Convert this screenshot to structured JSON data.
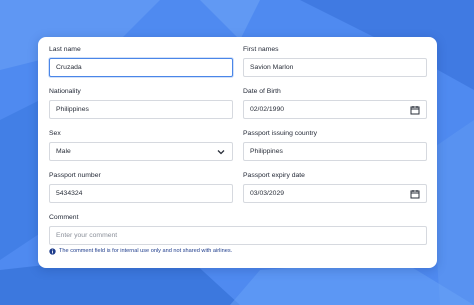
{
  "form": {
    "last_name": {
      "label": "Last name",
      "value": "Cruzada"
    },
    "first_names": {
      "label": "First names",
      "value": "Savion Marlon"
    },
    "nationality": {
      "label": "Nationality",
      "value": "Philippines"
    },
    "date_of_birth": {
      "label": "Date of Birth",
      "value": "02/02/1990"
    },
    "sex": {
      "label": "Sex",
      "value": "Male"
    },
    "passport_issuing_country": {
      "label": "Passport issuing country",
      "value": "Philippines"
    },
    "passport_number": {
      "label": "Passport number",
      "value": "5434324"
    },
    "passport_expiry_date": {
      "label": "Passport expiry date",
      "value": "03/03/2029"
    },
    "comment": {
      "label": "Comment",
      "placeholder": "Enter your comment"
    },
    "note": "The comment field is for internal use only and not shared with airlines."
  },
  "colors": {
    "accent": "#4a86e8",
    "background": "#4a86e8",
    "note": "#1f3d8c"
  }
}
